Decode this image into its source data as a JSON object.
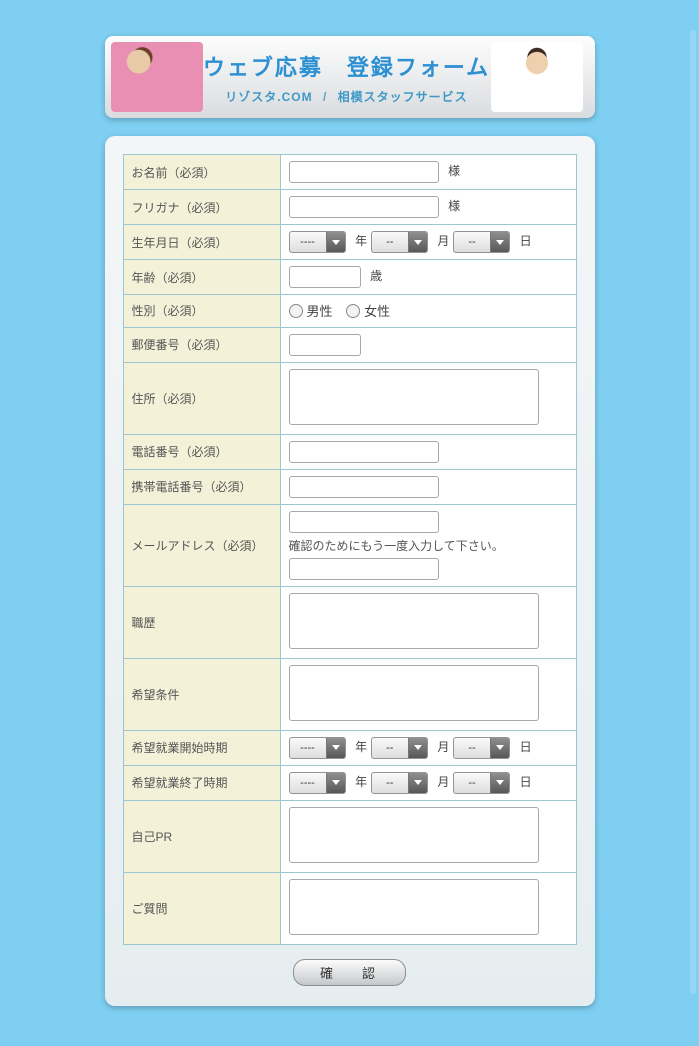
{
  "header": {
    "title": "ウェブ応募　登録フォーム",
    "subLeft": "リゾスタ.COM",
    "subSep": "/",
    "subRight": "相模スタッフサービス"
  },
  "selectPlaceholders": {
    "dash4": "----",
    "dash2": "--"
  },
  "dateUnits": {
    "year": "年",
    "month": "月",
    "day": "日"
  },
  "rows": {
    "name": {
      "label": "お名前（必須）",
      "suffix": "様"
    },
    "furigana": {
      "label": "フリガナ（必須）",
      "suffix": "様"
    },
    "birth": {
      "label": "生年月日（必須）"
    },
    "age": {
      "label": "年齢（必須）",
      "suffix": "歳"
    },
    "gender": {
      "label": "性別（必須）",
      "opt1": "男性",
      "opt2": "女性"
    },
    "postal": {
      "label": "郵便番号（必須）"
    },
    "address": {
      "label": "住所（必須）"
    },
    "phone": {
      "label": "電話番号（必須）"
    },
    "mobile": {
      "label": "携帯電話番号（必須）"
    },
    "email": {
      "label": "メールアドレス（必須）",
      "note": "確認のためにもう一度入力して下さい。"
    },
    "career": {
      "label": "職歴"
    },
    "conditions": {
      "label": "希望条件"
    },
    "startPeriod": {
      "label": "希望就業開始時期"
    },
    "endPeriod": {
      "label": "希望就業終了時期"
    },
    "pr": {
      "label": "自己PR"
    },
    "question": {
      "label": "ご質問"
    }
  },
  "submit": {
    "label": "確　認"
  }
}
